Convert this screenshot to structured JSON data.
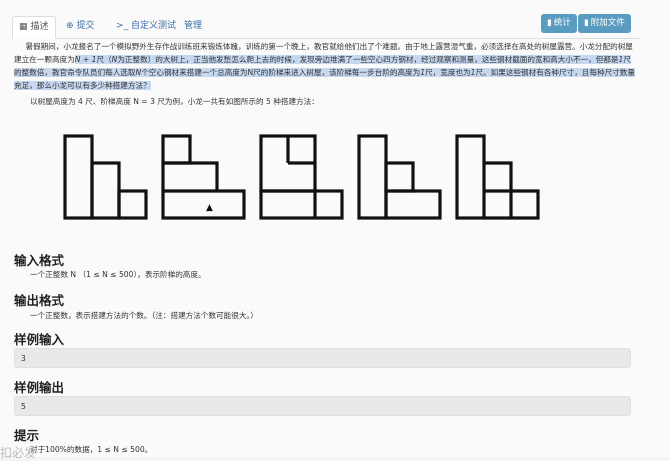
{
  "tabs": [
    {
      "icon": "document-icon",
      "glyph": "▦",
      "label": "描述"
    },
    {
      "icon": "submit-icon",
      "glyph": "⊕",
      "label": "提交"
    },
    {
      "icon": "terminal-icon",
      "glyph": ">_",
      "label": "自定义测试"
    },
    {
      "icon": "",
      "glyph": "",
      "label": "管理"
    }
  ],
  "buttons": {
    "stats": {
      "glyph": "▮",
      "label": "统计"
    },
    "attachments": {
      "glyph": "▮",
      "label": "附加文件"
    }
  },
  "statement": {
    "para1_plain": "暑假期间，小龙报名了一个模拟野外生存作战训练班来锻炼体魄，训练的第一个晚上，教官就给他们出了个难题。由于地上露营湿气重，必须选择在高处的树屋露营。小龙分配的树屋建立在一颗高度为",
    "para1_math1": "N + 1",
    "para1_a": "尺（",
    "para1_math2": "N",
    "para1_b": "为正整数）的大树上，正当他发愁怎么爬上去的时候，发现旁边堆满了一些空心四方钢材，经过观察和测量，这些钢材截面的宽和高大小不一，但都是",
    "para1_math3": "1",
    "para1_c": "尺的整数倍，教官命令队员们每人选取",
    "para1_math4": "N",
    "para1_d": "个空心钢材来搭建一个总高度为N尺的阶梯来进入树屋，该阶梯每一步台阶的高度为",
    "para1_math5": "1",
    "para1_e": "尺，宽度也为",
    "para1_math6": "1",
    "para1_f": "尺。如果这些钢材有各种尺寸，且每种尺寸数量充足，那么小龙可以有多少种搭建方法？",
    "para2": "以树屋高度为 4 尺、阶梯高度 N = 3 尺为例，小龙一共有如图所示的 5 种搭建方法："
  },
  "sections": {
    "input_title": "输入格式",
    "input_text": "一个正整数 N （1 ≤ N ≤ 500），表示阶梯的高度。",
    "output_title": "输出格式",
    "output_text": "一个正整数，表示搭建方法的个数。（注：搭建方法个数可能很大。）",
    "sample_in_title": "样例输入",
    "sample_in": "3",
    "sample_out_title": "样例输出",
    "sample_out": "5",
    "hint_title": "提示",
    "hint_text": "对于100%的数据，1 ≤ N ≤ 500。"
  },
  "watermark": "扣必发"
}
